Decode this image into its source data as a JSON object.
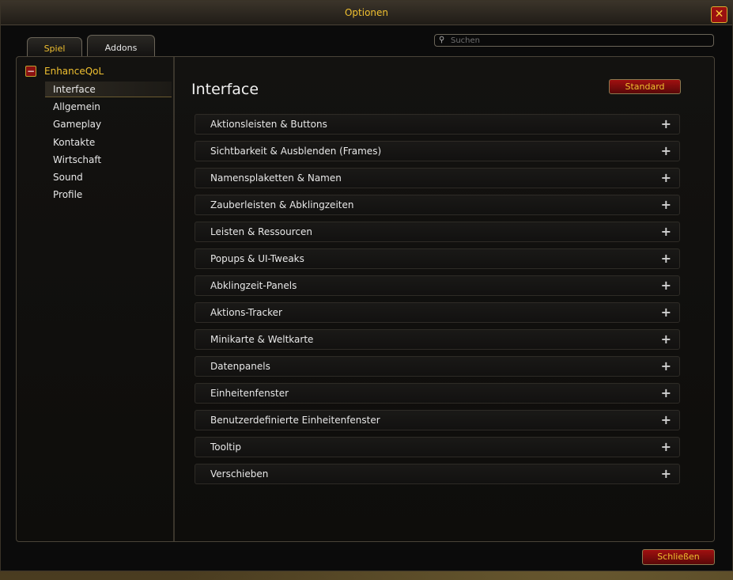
{
  "window": {
    "title": "Optionen"
  },
  "tabs": [
    {
      "label": "Spiel",
      "active": true
    },
    {
      "label": "Addons",
      "active": false
    }
  ],
  "search": {
    "placeholder": "Suchen",
    "value": ""
  },
  "sidebar": {
    "root": {
      "label": "EnhanceQoL",
      "toggle": "−"
    },
    "items": [
      {
        "label": "Interface",
        "selected": true
      },
      {
        "label": "Allgemein",
        "selected": false
      },
      {
        "label": "Gameplay",
        "selected": false
      },
      {
        "label": "Kontakte",
        "selected": false
      },
      {
        "label": "Wirtschaft",
        "selected": false
      },
      {
        "label": "Sound",
        "selected": false
      },
      {
        "label": "Profile",
        "selected": false
      }
    ]
  },
  "content": {
    "title": "Interface",
    "defaults_button": "Standard",
    "sections": [
      "Aktionsleisten & Buttons",
      "Sichtbarkeit & Ausblenden (Frames)",
      "Namensplaketten & Namen",
      "Zauberleisten & Abklingzeiten",
      "Leisten & Ressourcen",
      "Popups & UI-Tweaks",
      "Abklingzeit-Panels",
      "Aktions-Tracker",
      "Minikarte & Weltkarte",
      "Datenpanels",
      "Einheitenfenster",
      "Benutzerdefinierte Einheitenfenster",
      "Tooltip",
      "Verschieben"
    ],
    "expand_glyph": "+"
  },
  "footer": {
    "close_button": "Schließen"
  },
  "icons": {
    "close": "close-icon",
    "search": "search-icon",
    "expand": "plus-icon",
    "collapse": "minus-icon"
  },
  "colors": {
    "accent_gold": "#f0c030",
    "button_red": "#a01010",
    "panel_bg": "#131210"
  }
}
